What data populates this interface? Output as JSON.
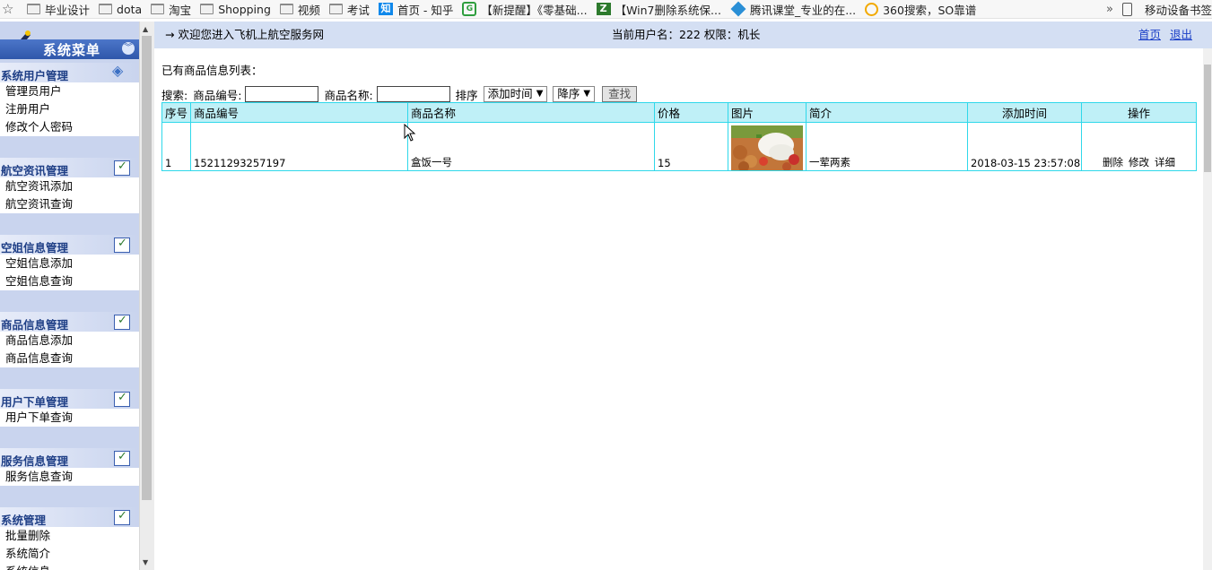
{
  "bookmarks": {
    "items": [
      {
        "label": "毕业设计",
        "icon": "folder-icon"
      },
      {
        "label": "dota",
        "icon": "folder-icon"
      },
      {
        "label": "淘宝",
        "icon": "folder-icon"
      },
      {
        "label": "Shopping",
        "icon": "folder-icon"
      },
      {
        "label": "视频",
        "icon": "folder-icon"
      },
      {
        "label": "考试",
        "icon": "folder-icon"
      },
      {
        "label": "首页 - 知乎",
        "icon": "zhihu-icon",
        "icon_text": "知"
      },
      {
        "label": "【新提醒】《零基础...",
        "icon": "green-g-icon",
        "icon_text": "G"
      },
      {
        "label": "【Win7删除系统保...",
        "icon": "zed-icon",
        "icon_text": "Z"
      },
      {
        "label": "腾讯课堂_专业的在...",
        "icon": "tencent-icon"
      },
      {
        "label": "360搜索，SO靠谱",
        "icon": "search360-icon"
      }
    ],
    "more": "»",
    "mobile": "移动设备书签"
  },
  "sidebar": {
    "title": "系统菜单",
    "sections": [
      {
        "title": "系统用户管理",
        "items": [
          "管理员用户",
          "注册用户",
          "修改个人密码"
        ]
      },
      {
        "title": "航空资讯管理",
        "items": [
          "航空资讯添加",
          "航空资讯查询"
        ]
      },
      {
        "title": "空姐信息管理",
        "items": [
          "空姐信息添加",
          "空姐信息查询"
        ]
      },
      {
        "title": "商品信息管理",
        "items": [
          "商品信息添加",
          "商品信息查询"
        ]
      },
      {
        "title": "用户下单管理",
        "items": [
          "用户下单查询"
        ]
      },
      {
        "title": "服务信息管理",
        "items": [
          "服务信息查询"
        ]
      },
      {
        "title": "系统管理",
        "items": [
          "批量删除",
          "系统简介",
          "系统信息"
        ]
      }
    ]
  },
  "topbar": {
    "arrow": "→",
    "welcome": "欢迎您进入飞机上航空服务网",
    "user_info": "当前用户名：222  权限：机长",
    "home": "首页",
    "logout": "退出"
  },
  "main": {
    "list_title": "已有商品信息列表：",
    "search": {
      "label": "搜索:",
      "code_label": "商品编号:",
      "code_value": "",
      "name_label": "商品名称:",
      "name_value": "",
      "sort_label": "排序",
      "sort_field": "添加时间",
      "sort_order": "降序",
      "button": "查找"
    },
    "table": {
      "headers": [
        "序号",
        "商品编号",
        "商品名称",
        "价格",
        "图片",
        "简介",
        "添加时间",
        "操作"
      ],
      "rows": [
        {
          "index": "1",
          "code": "15211293257197",
          "name": "盒饭一号",
          "price": "15",
          "intro": "一荤两素",
          "time": "2018-03-15 23:57:08",
          "ops": [
            "删除",
            "修改",
            "详细"
          ]
        }
      ]
    }
  },
  "colors": {
    "header_bg": "#d4dff3",
    "table_border": "#2fd8ea",
    "table_head_bg": "#bff0f7",
    "sidebar_bg": "#c9d4ee",
    "link": "#1a3fc7"
  }
}
